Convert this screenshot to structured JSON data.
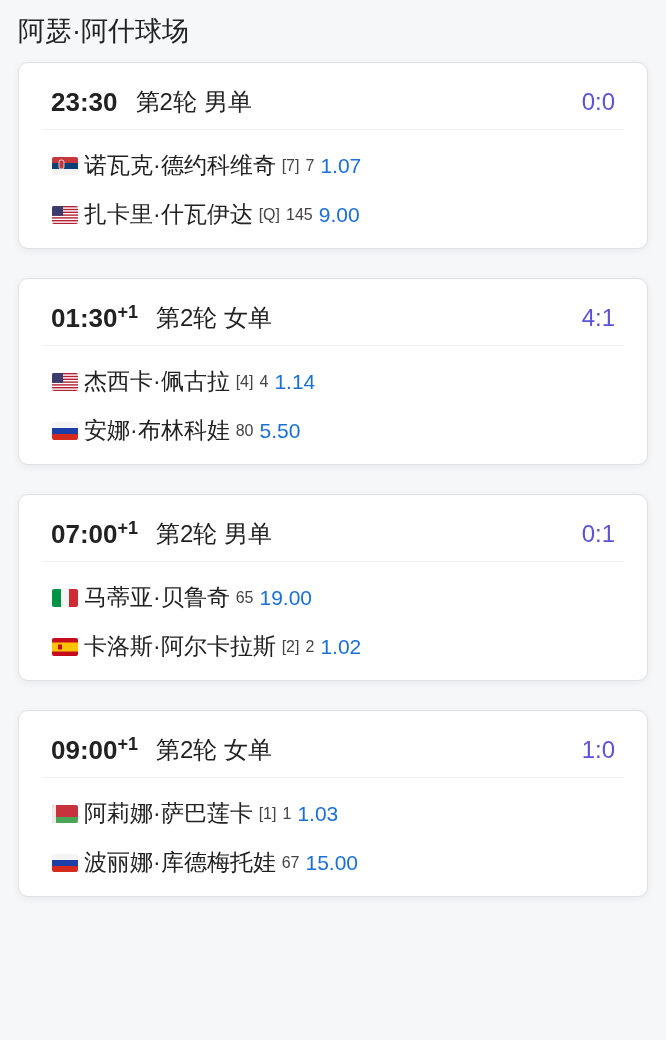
{
  "venue": {
    "title": "阿瑟·阿什球场"
  },
  "matches": [
    {
      "time": "23:30",
      "round": "第2轮 男单",
      "score": "0:0",
      "players": [
        {
          "kind": "serbia",
          "name": "诺瓦克·德约科维奇",
          "seed": "[7]",
          "rank": "7",
          "odds": "1.07"
        },
        {
          "kind": "usa",
          "name": "扎卡里·什瓦伊达",
          "seed": "[Q]",
          "rank": "145",
          "odds": "9.00"
        }
      ]
    },
    {
      "time": "01:30$^{+1}$",
      "round": "第2轮 女单",
      "score": "4:1",
      "players": [
        {
          "kind": "usa",
          "name": "杰西卡·佩古拉",
          "seed": "[4]",
          "rank": "4",
          "odds": "1.14"
        },
        {
          "kind": "russia",
          "name": "安娜·布林科娃",
          "rank": "80",
          "odds": "5.50"
        }
      ]
    },
    {
      "time": "07:00$^{+1}$",
      "round": "第2轮 男单",
      "score": "0:1",
      "players": [
        {
          "kind": "italy",
          "name": "马蒂亚·贝鲁奇",
          "rank": "65",
          "odds": "19.00"
        },
        {
          "kind": "spain",
          "name": "卡洛斯·阿尔卡拉斯",
          "seed": "[2]",
          "rank": "2",
          "odds": "1.02"
        }
      ]
    },
    {
      "time": "09:00$^{+1}$",
      "round": "第2轮 女单",
      "score": "1:0",
      "players": [
        {
          "kind": "belarus",
          "name": "阿莉娜·萨巴莲卡",
          "seed": "[1]",
          "rank": "1",
          "odds": "1.03"
        },
        {
          "kind": "russia",
          "name": "波丽娜·库德梅托娃",
          "rank": "67",
          "odds": "15.00"
        }
      ]
    }
  ]
}
